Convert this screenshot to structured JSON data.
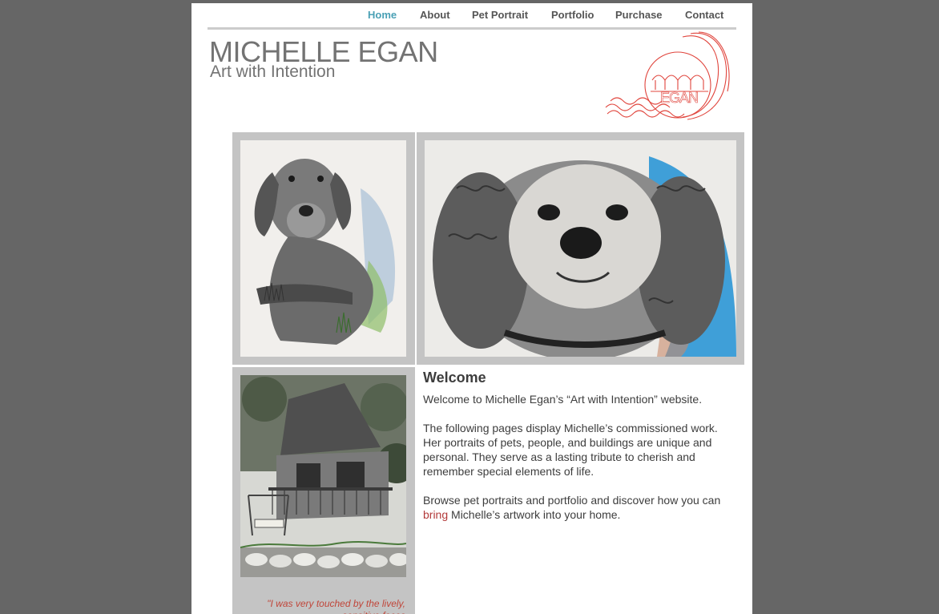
{
  "nav": {
    "items": [
      {
        "label": "Home",
        "active": true
      },
      {
        "label": "About",
        "active": false
      },
      {
        "label": "Pet Portrait",
        "active": false
      },
      {
        "label": "Portfolio",
        "active": false
      },
      {
        "label": "Purchase",
        "active": false
      },
      {
        "label": "Contact",
        "active": false
      }
    ]
  },
  "header": {
    "name": "MICHELLE EGAN",
    "tagline": "Art with Intention",
    "logo_text": "mm EGAN"
  },
  "gallery": {
    "images": [
      "hound-dog-drawing",
      "spaniel-drawing",
      "cabin-drawing"
    ]
  },
  "welcome": {
    "title": "Welcome",
    "intro": "Welcome to Michelle Egan’s “Art with Intention” website.",
    "body": "The following pages display Michelle’s commissioned work. Her portraits of pets, people, and buildings are unique and personal.  They serve as a lasting tribute to cherish and remember special elements of life.",
    "cta_pre": "Browse ",
    "link_pet": "pet portraits",
    "cta_mid1": " and ",
    "link_portfolio": "portfolio",
    "cta_mid2": " and discover how you can ",
    "link_bring": "bring",
    "cta_post": " Michelle’s artwork into your home."
  },
  "testimonial": {
    "text": "\"I was very touched by the lively, sensitive faces"
  },
  "colors": {
    "background": "#666666",
    "accent": "#4aa0b5",
    "link_red": "#b33a3a",
    "logo_red": "#e0443c",
    "frame": "#c4c4c4"
  }
}
